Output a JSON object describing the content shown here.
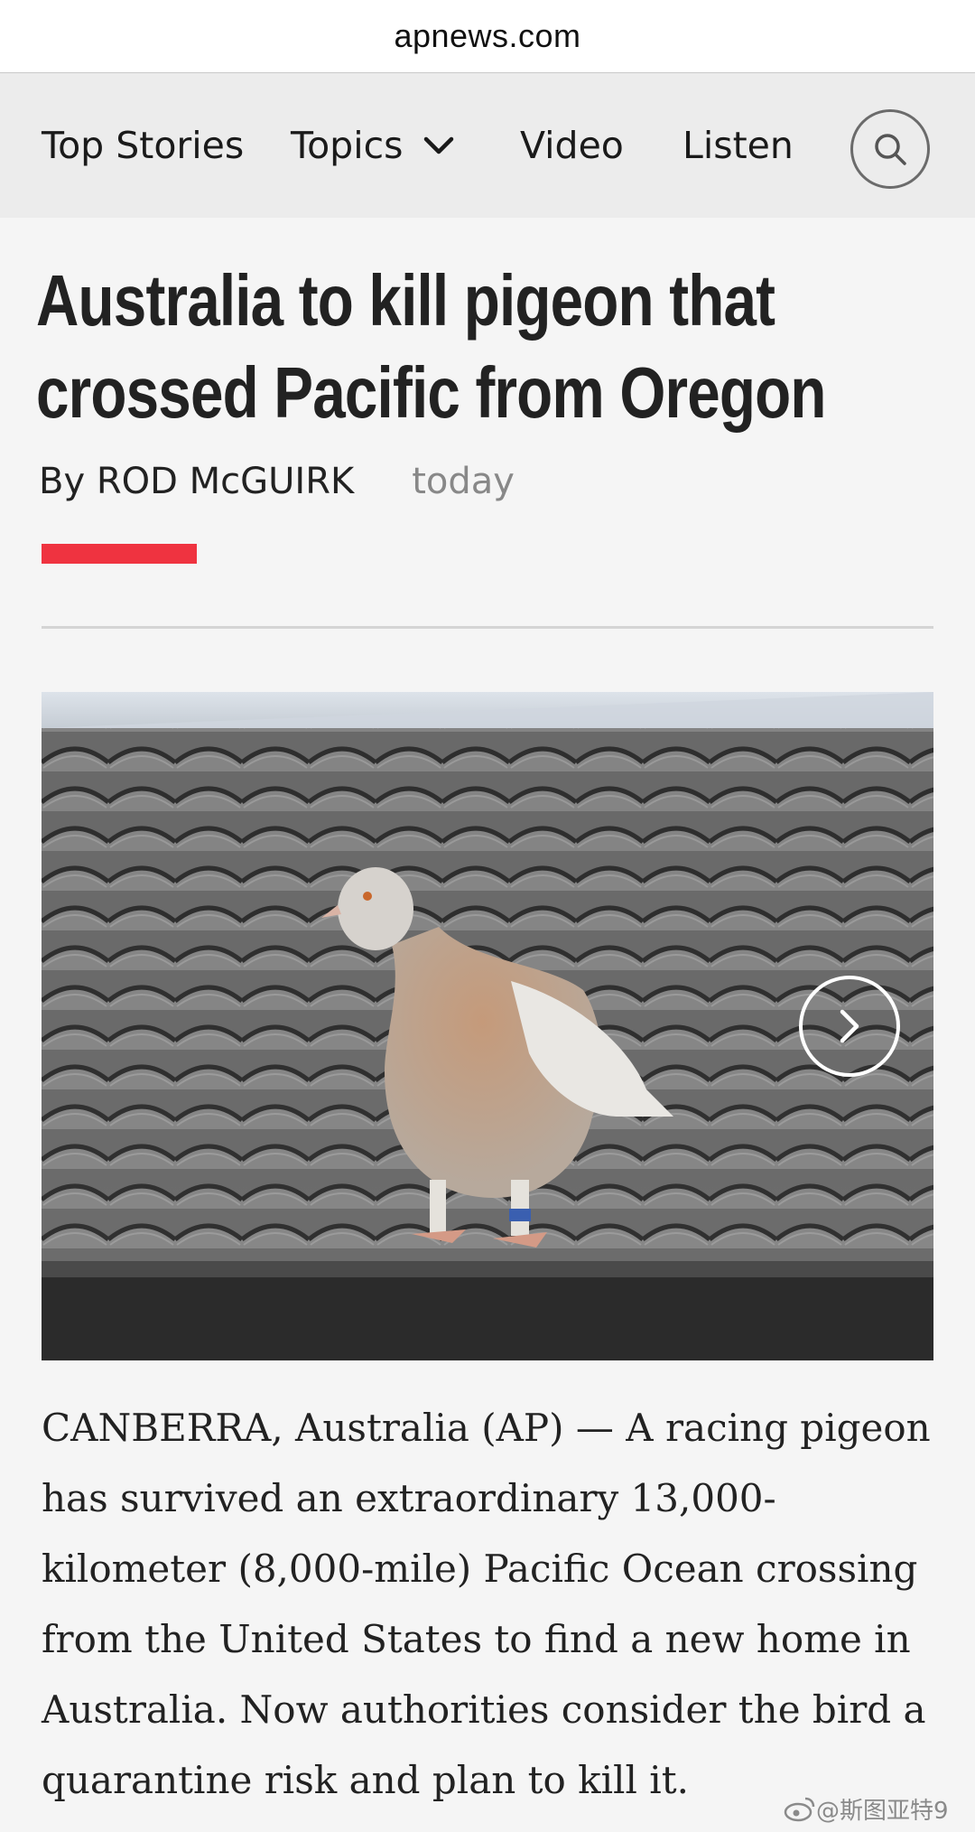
{
  "browser": {
    "url": "apnews.com"
  },
  "nav": {
    "items": [
      {
        "label": "Top Stories"
      },
      {
        "label": "Topics"
      },
      {
        "label": "Video"
      },
      {
        "label": "Listen"
      }
    ],
    "search_icon": "search-icon",
    "topics_icon": "chevron-down-icon"
  },
  "article": {
    "headline_lines": [
      "Australia to kill pigeon that",
      "crossed Pacific from Oregon"
    ],
    "byline": "By ROD McGUIRK",
    "date": "today",
    "accent_color": "#ef3340",
    "photo": {
      "subject": "pigeon-photo",
      "next_icon": "chevron-right-icon"
    },
    "body_lines": [
      "CANBERRA, Australia (AP) — A racing pigeon",
      "has survived an extraordinary 13,000-",
      "kilometer (8,000-mile) Pacific Ocean crossing",
      "from the United States to find a new home in",
      "Australia. Now authorities consider the bird a",
      "quarantine risk and plan to kill it."
    ]
  },
  "watermark": {
    "text": "@斯图亚特9"
  }
}
